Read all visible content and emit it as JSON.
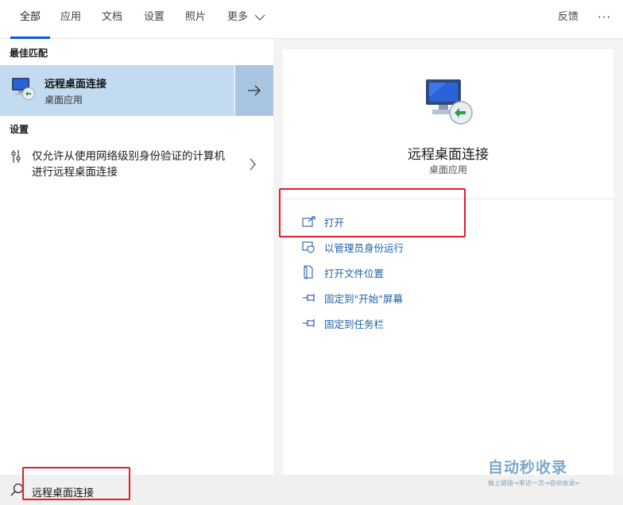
{
  "tabs": [
    {
      "label": "全部",
      "active": true
    },
    {
      "label": "应用"
    },
    {
      "label": "文档"
    },
    {
      "label": "设置"
    },
    {
      "label": "照片"
    },
    {
      "label": "更多"
    }
  ],
  "topbar": {
    "feedback": "反馈",
    "more": "···"
  },
  "left": {
    "best_match_heading": "最佳匹配",
    "best_match": {
      "title": "远程桌面连接",
      "subtitle": "桌面应用"
    },
    "settings_heading": "设置",
    "settings_item": "仅允许从使用网络级别身份验证的计算机进行远程桌面连接"
  },
  "right": {
    "app_title": "远程桌面连接",
    "app_subtitle": "桌面应用",
    "actions": [
      {
        "label": "打开",
        "icon": "open-icon"
      },
      {
        "label": "以管理员身份运行",
        "icon": "shield-icon"
      },
      {
        "label": "打开文件位置",
        "icon": "file-location-icon"
      },
      {
        "label": "固定到\"开始\"屏幕",
        "icon": "pin-icon"
      },
      {
        "label": "固定到任务栏",
        "icon": "pin-icon"
      }
    ]
  },
  "search": {
    "query": "远程桌面连接"
  },
  "watermark": {
    "title": "自动秒收录",
    "subtitle": "做上链接→来访一次→自动收录←"
  },
  "colors": {
    "accent": "#0a5bd6",
    "selected_bg": "#c2dbf1",
    "link": "#1f5fa8",
    "annotation": "#e0202a"
  }
}
